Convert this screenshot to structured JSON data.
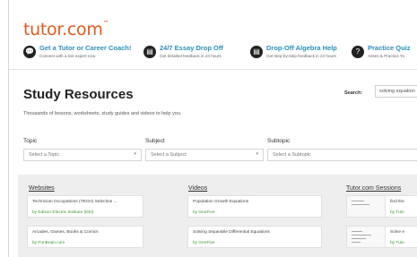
{
  "logo": {
    "text": "tutor.com",
    "mark": "™"
  },
  "promos": [
    {
      "icon": "chat-bubble-icon",
      "glyph": "💬",
      "title": "Get a Tutor or Career Coach!",
      "subtitle": "Connect with a live expert now"
    },
    {
      "icon": "document-icon",
      "glyph": "▤",
      "title": "24/7 Essay Drop Off",
      "subtitle": "Get detailed feedback in 24 hours"
    },
    {
      "icon": "document-icon",
      "glyph": "▤",
      "title": "Drop-Off Algebra Help",
      "subtitle": "Get step-by-step feedback in 24 hours"
    },
    {
      "icon": "question-icon",
      "glyph": "?",
      "title": "Practice Quiz",
      "subtitle": "Asses & Practice Yo"
    }
  ],
  "header": {
    "title": "Study Resources",
    "search_label": "Search:",
    "search_value": "solving equation",
    "subtitle": "Thousands of lessons, worksheets, study guides and videos to help you."
  },
  "filters": [
    {
      "label": "Topic",
      "placeholder": "Select a Topic"
    },
    {
      "label": "Subject",
      "placeholder": "Select a Subject"
    },
    {
      "label": "Subtopic",
      "placeholder": "Select a Subtopic"
    }
  ],
  "columns": {
    "websites": {
      "heading": "Websites",
      "items": [
        {
          "name": "Technician Occupations (TECH) Selection ...",
          "by": "by Edison Electric Institute (EEI)"
        },
        {
          "name": "Arcades, Games, Books & Comics",
          "by": "by FunBrain.com"
        }
      ]
    },
    "videos": {
      "heading": "Videos",
      "items": [
        {
          "name": "Population Growth Equations",
          "by": "by GeoFive"
        },
        {
          "name": "Solving Separable Differential Equations",
          "by": "by GeoFive"
        }
      ]
    },
    "sessions": {
      "heading": "Tutor.com Sessions",
      "items": [
        {
          "name": "find the",
          "by": "by Tuto"
        },
        {
          "name": "Solve e",
          "by": "by Tuto"
        }
      ]
    }
  }
}
